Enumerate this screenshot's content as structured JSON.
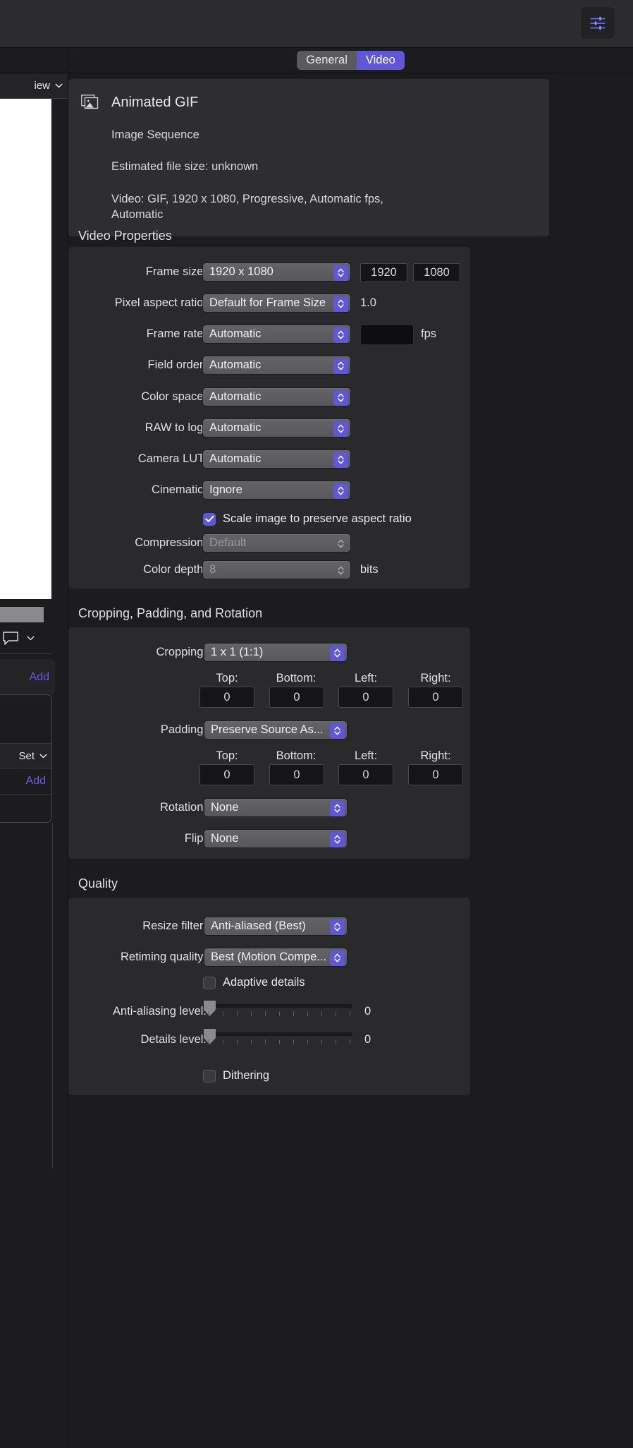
{
  "toolbar": {
    "inspector_icon": "sliders-icon"
  },
  "sidebar": {
    "view_label": "iew",
    "view_chevron_icon": "chevron-down-icon",
    "comment_icon": "comment-bubble-icon",
    "comment_chevron_icon": "chevron-down-icon",
    "add_label_1": "Add",
    "set_label": "Set",
    "set_chevron_icon": "chevron-down-icon",
    "add_label_2": "Add"
  },
  "tabs": {
    "general": "General",
    "video": "Video",
    "active": "Video"
  },
  "info": {
    "icon": "image-sequence-icon",
    "title": "Animated GIF",
    "subtitle": "Image Sequence",
    "filesize": "Estimated file size: unknown",
    "video_summary": "Video: GIF, 1920 x 1080, Progressive, Automatic fps, Automatic"
  },
  "video_properties": {
    "section_title": "Video Properties",
    "frame_size": {
      "label": "Frame size:",
      "value": "1920 x 1080",
      "width": "1920",
      "height": "1080"
    },
    "pixel_aspect_ratio": {
      "label": "Pixel aspect ratio:",
      "value": "Default for Frame Size",
      "ratio": "1.0"
    },
    "frame_rate": {
      "label": "Frame rate:",
      "value": "Automatic",
      "fps_value": "",
      "fps_unit": "fps"
    },
    "field_order": {
      "label": "Field order:",
      "value": "Automatic"
    },
    "color_space": {
      "label": "Color space:",
      "value": "Automatic"
    },
    "raw_to_log": {
      "label": "RAW to log:",
      "value": "Automatic"
    },
    "camera_lut": {
      "label": "Camera LUT:",
      "value": "Automatic"
    },
    "cinematic": {
      "label": "Cinematic:",
      "value": "Ignore"
    },
    "scale_image": {
      "label": "Scale image to preserve aspect ratio",
      "checked": true
    },
    "compression": {
      "label": "Compression:",
      "value": "Default",
      "disabled": true
    },
    "color_depth": {
      "label": "Color depth:",
      "value": "8",
      "unit": "bits",
      "disabled": true
    }
  },
  "cropping": {
    "section_title": "Cropping, Padding, and Rotation",
    "cropping_row": {
      "label": "Cropping:",
      "value": "1 x 1 (1:1)"
    },
    "crop_headers": [
      "Top:",
      "Bottom:",
      "Left:",
      "Right:"
    ],
    "crop_values": [
      "0",
      "0",
      "0",
      "0"
    ],
    "padding_row": {
      "label": "Padding:",
      "value": "Preserve Source As..."
    },
    "pad_headers": [
      "Top:",
      "Bottom:",
      "Left:",
      "Right:"
    ],
    "pad_values": [
      "0",
      "0",
      "0",
      "0"
    ],
    "rotation": {
      "label": "Rotation:",
      "value": "None"
    },
    "flip": {
      "label": "Flip:",
      "value": "None"
    }
  },
  "quality": {
    "section_title": "Quality",
    "resize_filter": {
      "label": "Resize filter:",
      "value": "Anti-aliased (Best)"
    },
    "retiming_quality": {
      "label": "Retiming quality:",
      "value": "Best (Motion Compe..."
    },
    "adaptive_details": {
      "label": "Adaptive details",
      "checked": false
    },
    "anti_aliasing": {
      "label": "Anti-aliasing level:",
      "value": "0"
    },
    "details_level": {
      "label": "Details level:",
      "value": "0"
    },
    "dithering": {
      "label": "Dithering",
      "checked": false
    }
  },
  "colors": {
    "accent": "#5f57d8",
    "link": "#6b5ce7",
    "panel": "#2a2a2c",
    "background": "#1c1c1e"
  }
}
